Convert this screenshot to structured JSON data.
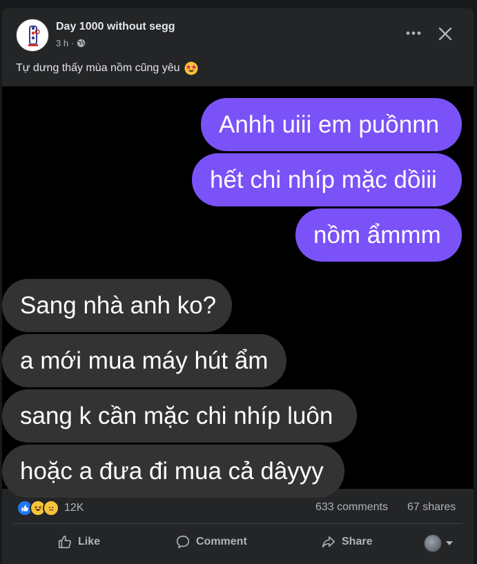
{
  "post": {
    "page_name": "Day 1000 without segg",
    "time": "3 h",
    "separator": "·",
    "caption": "Tự dưng thấy mùa nồm cũng yêu",
    "caption_emoji": "star-struck-emoji",
    "icons": [
      "globe-icon",
      "more-icon",
      "close-icon"
    ]
  },
  "chat": {
    "sent": [
      "Anhh uiii em puồnnn",
      "hết chi nhíp mặc dồiii",
      "nồm ẩmmm"
    ],
    "received": [
      "Sang nhà anh ko?",
      "a mới mua máy hút ẩm",
      "sang k cần mặc chi nhíp luôn",
      "hoặc a đưa đi mua cả dâyyy"
    ],
    "colors": {
      "sent_bubble": "#7b52f8",
      "received_bubble": "#333333",
      "background": "#000000"
    }
  },
  "stats": {
    "reactions": [
      "like",
      "haha",
      "sad"
    ],
    "reaction_count": "12K",
    "comments": "633 comments",
    "shares": "67 shares"
  },
  "actions": {
    "like": "Like",
    "comment": "Comment",
    "share": "Share"
  },
  "colors": {
    "card": "#242526",
    "text_primary": "#e4e6eb",
    "text_secondary": "#b0b3b8",
    "like_blue": "#2078f4"
  }
}
